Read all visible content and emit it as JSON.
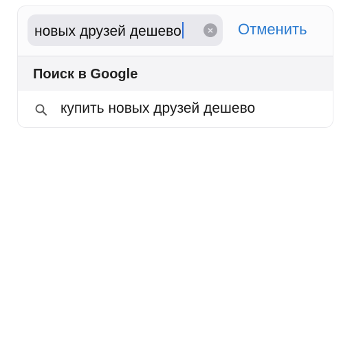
{
  "search": {
    "query": "новых друзей дешево",
    "clear_icon": "clear-circle-icon",
    "cancel_label": "Отменить"
  },
  "section": {
    "title": "Поиск в Google"
  },
  "suggestions": [
    {
      "icon": "search-icon",
      "text": "купить новых друзей дешево"
    }
  ],
  "colors": {
    "accent": "#2b7bd0",
    "caret": "#2f6fd6",
    "field_background": "#e8e8ed",
    "section_background": "#f4f4f6"
  }
}
